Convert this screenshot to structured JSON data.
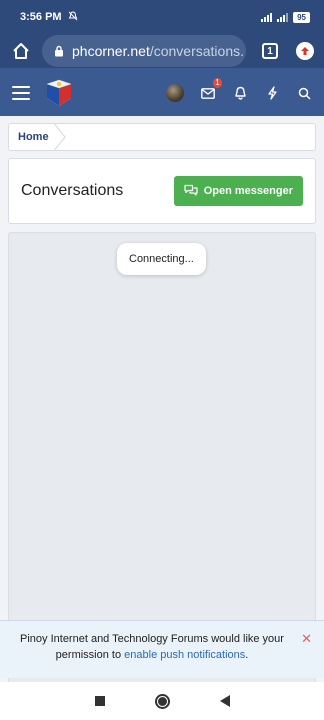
{
  "status_bar": {
    "time": "3:56 PM",
    "battery": "95"
  },
  "browser": {
    "url_domain": "phcorner.net",
    "url_path": "/conversations.",
    "tab_count": "1"
  },
  "header": {
    "inbox_badge": "1",
    "icons": [
      "menu-icon",
      "site-logo",
      "avatar",
      "envelope-icon",
      "bell-icon",
      "bolt-icon",
      "search-icon"
    ]
  },
  "breadcrumb": {
    "home_label": "Home"
  },
  "page": {
    "title": "Conversations",
    "messenger_button_label": "Open messenger",
    "connecting_text": "Connecting..."
  },
  "notification": {
    "text_before": "Pinoy Internet and Technology Forums would like your permission to ",
    "link_text": "enable push notifications",
    "text_after": "."
  },
  "colors": {
    "header_bg": "#3b5a91",
    "statusbar_bg": "#2e4a7a",
    "button_green": "#4caf50",
    "link_blue": "#2d6cb0",
    "badge_red": "#e24b3b"
  }
}
